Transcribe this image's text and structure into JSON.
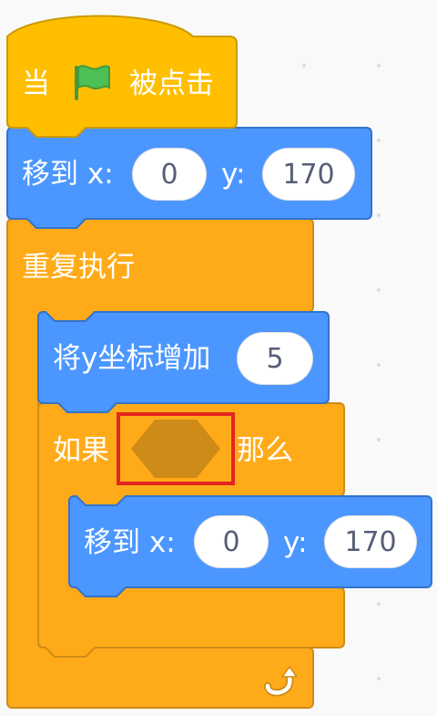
{
  "script": {
    "hat": {
      "prefix": "当",
      "suffix": "被点击",
      "flag_icon": "green-flag-icon"
    },
    "goto1": {
      "label": "移到 x:",
      "ylabel": "y:",
      "x": "0",
      "y": "170"
    },
    "forever": {
      "label": "重复执行",
      "loop_icon": "loop-arrow-icon"
    },
    "change_y": {
      "label": "将y坐标增加",
      "value": "5"
    },
    "if_block": {
      "prefix": "如果",
      "suffix": "那么"
    },
    "goto2": {
      "label": "移到 x:",
      "ylabel": "y:",
      "x": "0",
      "y": "170"
    }
  },
  "colors": {
    "events": "#ffbf00",
    "motion": "#4c97ff",
    "control": "#ffab19",
    "empty_slot": "#cf8b17",
    "highlight": "#e52521"
  }
}
